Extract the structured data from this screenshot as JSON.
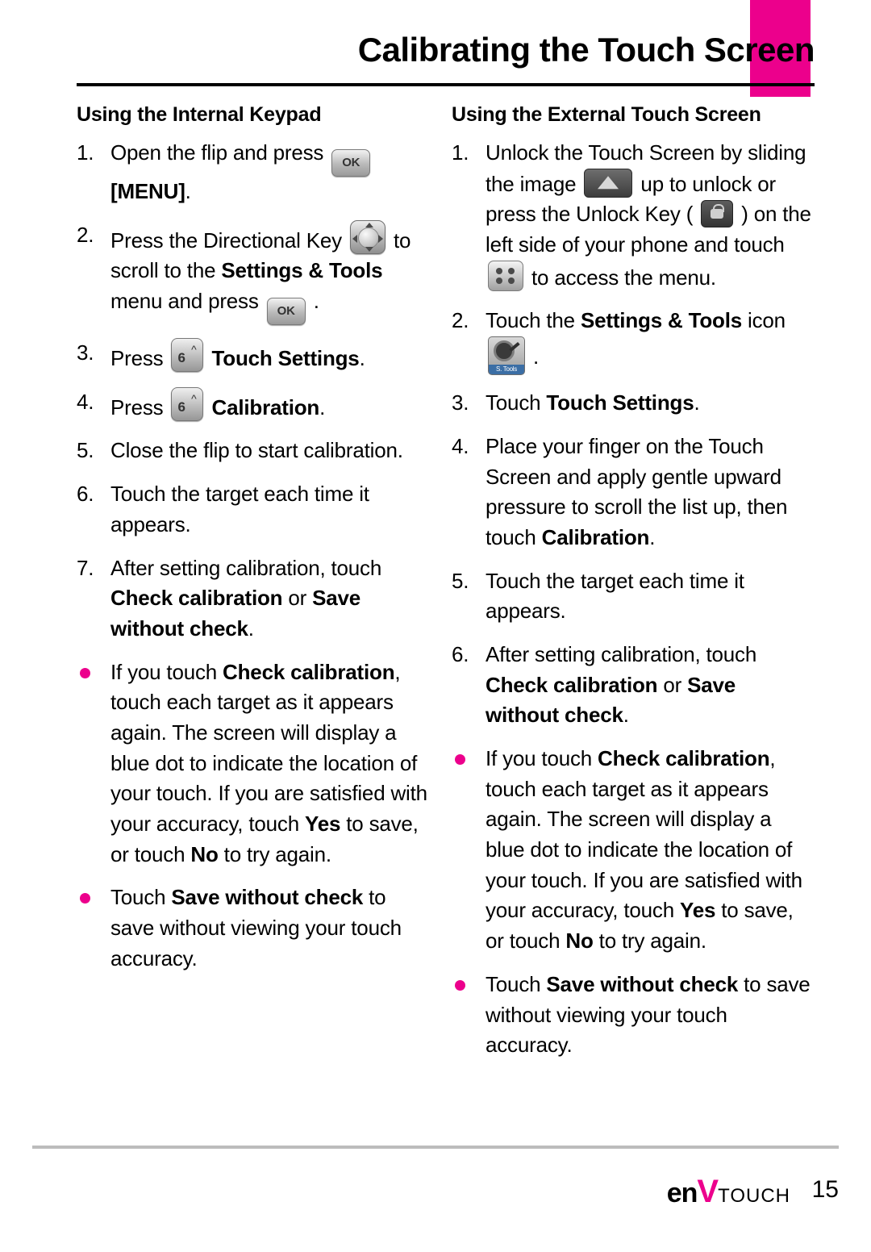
{
  "page": {
    "title": "Calibrating the Touch Screen",
    "number": "15",
    "brand": {
      "part1": "en",
      "v": "V",
      "part2": "TOUCH"
    }
  },
  "left": {
    "heading": "Using the Internal Keypad",
    "steps": [
      {
        "num": "1.",
        "segments": [
          {
            "text": "Open the flip and press ",
            "bold": false
          },
          {
            "icon": "ok-key-icon"
          },
          {
            "text": " ",
            "bold": false
          },
          {
            "text": "[MENU]",
            "bold": true
          },
          {
            "text": ".",
            "bold": false
          }
        ]
      },
      {
        "num": "2.",
        "segments": [
          {
            "text": "Press the Directional Key ",
            "bold": false
          },
          {
            "icon": "directional-key-icon"
          },
          {
            "text": " to scroll to the ",
            "bold": false
          },
          {
            "text": "Settings & Tools",
            "bold": true
          },
          {
            "text": " menu and press ",
            "bold": false
          },
          {
            "icon": "ok-key-icon"
          },
          {
            "text": " .",
            "bold": false
          }
        ]
      },
      {
        "num": "3.",
        "segments": [
          {
            "text": "Press ",
            "bold": false
          },
          {
            "icon": "number-6-key-icon"
          },
          {
            "text": "  ",
            "bold": false
          },
          {
            "text": "Touch Settings",
            "bold": true
          },
          {
            "text": ".",
            "bold": false
          }
        ]
      },
      {
        "num": "4.",
        "segments": [
          {
            "text": "Press ",
            "bold": false
          },
          {
            "icon": "number-6-key-icon"
          },
          {
            "text": "  ",
            "bold": false
          },
          {
            "text": "Calibration",
            "bold": true
          },
          {
            "text": ".",
            "bold": false
          }
        ]
      },
      {
        "num": "5.",
        "segments": [
          {
            "text": "Close the flip to start calibration.",
            "bold": false
          }
        ]
      },
      {
        "num": "6.",
        "segments": [
          {
            "text": "Touch the target each time it appears.",
            "bold": false
          }
        ]
      },
      {
        "num": "7.",
        "segments": [
          {
            "text": "After setting calibration, touch ",
            "bold": false
          },
          {
            "text": "Check calibration",
            "bold": true
          },
          {
            "text": " or ",
            "bold": false
          },
          {
            "text": "Save without check",
            "bold": true
          },
          {
            "text": ".",
            "bold": false
          }
        ]
      }
    ],
    "bullets": [
      {
        "segments": [
          {
            "text": "If you touch ",
            "bold": false
          },
          {
            "text": "Check calibration",
            "bold": true
          },
          {
            "text": ", touch each target as it appears again. The screen will display a blue dot to indicate the location of your touch. If you are satisfied with your accuracy, touch ",
            "bold": false
          },
          {
            "text": "Yes",
            "bold": true
          },
          {
            "text": " to save, or touch ",
            "bold": false
          },
          {
            "text": "No",
            "bold": true
          },
          {
            "text": "  to try again.",
            "bold": false
          }
        ]
      },
      {
        "segments": [
          {
            "text": "Touch ",
            "bold": false
          },
          {
            "text": "Save without check",
            "bold": true
          },
          {
            "text": " to save without viewing your touch accuracy.",
            "bold": false
          }
        ]
      }
    ]
  },
  "right": {
    "heading": "Using the External Touch Screen",
    "steps": [
      {
        "num": "1.",
        "segments": [
          {
            "text": "Unlock the Touch Screen by sliding the image ",
            "bold": false
          },
          {
            "icon": "slider-up-arrow-icon"
          },
          {
            "text": " up to unlock or press the Unlock Key ( ",
            "bold": false
          },
          {
            "icon": "unlock-key-icon"
          },
          {
            "text": " ) on the left side of your phone and touch ",
            "bold": false
          },
          {
            "icon": "menu-grid-icon"
          },
          {
            "text": " to access the menu.",
            "bold": false
          }
        ]
      },
      {
        "num": "2.",
        "segments": [
          {
            "text": "Touch the ",
            "bold": false
          },
          {
            "text": "Settings & Tools",
            "bold": true
          },
          {
            "text": " icon ",
            "bold": false
          },
          {
            "icon": "settings-tools-icon"
          },
          {
            "text": " .",
            "bold": false
          }
        ]
      },
      {
        "num": "3.",
        "segments": [
          {
            "text": "Touch ",
            "bold": false
          },
          {
            "text": "Touch Settings",
            "bold": true
          },
          {
            "text": ".",
            "bold": false
          }
        ]
      },
      {
        "num": "4.",
        "segments": [
          {
            "text": "Place your finger on the Touch Screen and apply gentle upward pressure to scroll the list up, then touch ",
            "bold": false
          },
          {
            "text": "Calibration",
            "bold": true
          },
          {
            "text": ".",
            "bold": false
          }
        ]
      },
      {
        "num": "5.",
        "segments": [
          {
            "text": "Touch the target each time it appears.",
            "bold": false
          }
        ]
      },
      {
        "num": "6.",
        "segments": [
          {
            "text": "After setting calibration, touch ",
            "bold": false
          },
          {
            "text": "Check calibration",
            "bold": true
          },
          {
            "text": " or ",
            "bold": false
          },
          {
            "text": "Save without check",
            "bold": true
          },
          {
            "text": ".",
            "bold": false
          }
        ]
      }
    ],
    "bullets": [
      {
        "segments": [
          {
            "text": "If you touch ",
            "bold": false
          },
          {
            "text": "Check calibration",
            "bold": true
          },
          {
            "text": ", touch each target as it appears again.  The screen will display a blue dot to indicate the location of your touch.  If you are satisfied with your accuracy, touch ",
            "bold": false
          },
          {
            "text": "Yes",
            "bold": true
          },
          {
            "text": " to save, or touch ",
            "bold": false
          },
          {
            "text": "No",
            "bold": true
          },
          {
            "text": " to try again.",
            "bold": false
          }
        ]
      },
      {
        "segments": [
          {
            "text": "Touch ",
            "bold": false
          },
          {
            "text": "Save without check",
            "bold": true
          },
          {
            "text": " to save without viewing your touch accuracy.",
            "bold": false
          }
        ]
      }
    ]
  },
  "icons": {
    "ok-key-icon": "OK",
    "number-6-key-icon": "6",
    "settings-tools-icon-label": "S. Tools"
  },
  "colors": {
    "accent": "#ec008c",
    "footer_rule": "#bcbcbc"
  }
}
